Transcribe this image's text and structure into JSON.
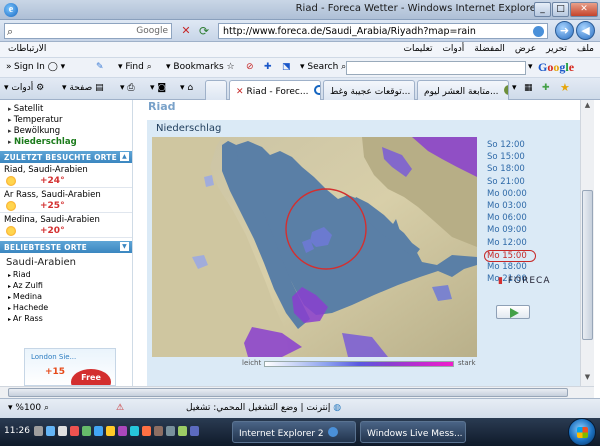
{
  "window": {
    "title": "Riad - Foreca Wetter - Windows Internet Explorer"
  },
  "addressbar": {
    "search_label": "Google",
    "url": "http://www.foreca.de/Saudi_Arabia/Riyadh?map=rain"
  },
  "menubar": {
    "links_label": "الارتباطات",
    "menus": [
      "ملف",
      "تحرير",
      "عرض",
      "المفضلة",
      "أدوات",
      "تعليمات"
    ]
  },
  "google_toolbar": {
    "sign_in": "Sign In",
    "find": "Find",
    "bookmarks": "Bookmarks",
    "search": "Search",
    "brand": "Google"
  },
  "tabs": {
    "tools_label": "أدوات",
    "page_label": "صفحة",
    "items": [
      "Riad - Forec...",
      "توقعات عجيبة وغط...",
      "متابعة العشر ليوم..."
    ]
  },
  "sidebar": {
    "sub_nav": [
      "Satellit",
      "Temperatur",
      "Bewölkung",
      "Niederschlag"
    ],
    "recent_header": "ZULETZT BESUCHTE ORTE",
    "recent": [
      {
        "name": "Riad, Saudi-Arabien",
        "temp": "+24°"
      },
      {
        "name": "Ar Rass, Saudi-Arabien",
        "temp": "+25°"
      },
      {
        "name": "Medina, Saudi-Arabien",
        "temp": "+20°"
      }
    ],
    "popular_header": "BELIEBTESTE ORTE",
    "country": "Saudi-Arabien",
    "country_list": [
      "Riad",
      "Az Zulfi",
      "Medina",
      "Hachede",
      "Ar Rass"
    ],
    "ad": {
      "text": "London Sie...",
      "num": "+15",
      "badge": "Free"
    }
  },
  "main": {
    "faded_heading": "Riad",
    "panel_title": "Niederschlag",
    "legend_low": "leicht",
    "legend_high": "stark",
    "times": [
      "So 12:00",
      "So 15:00",
      "So 18:00",
      "So 21:00",
      "Mo 00:00",
      "Mo 03:00",
      "Mo 06:00",
      "Mo 09:00",
      "Mo 12:00",
      "Mo 15:00",
      "Mo 18:00",
      "Mo 21:00"
    ],
    "selected_time_index": 9,
    "brand": "FORECA"
  },
  "statusbar": {
    "zone": "إنترنت | وضع التشغيل المحمي: تشغيل",
    "zoom": "%100"
  },
  "taskbar": {
    "clock": "11:26",
    "buttons": [
      "Internet Explorer 2",
      "Windows Live Mess..."
    ]
  },
  "colors": {
    "accent": "#3a86c0",
    "rain_purple": "#8a3fd0",
    "temp_red": "#d32f2f",
    "time_link": "#2f6aa8"
  }
}
